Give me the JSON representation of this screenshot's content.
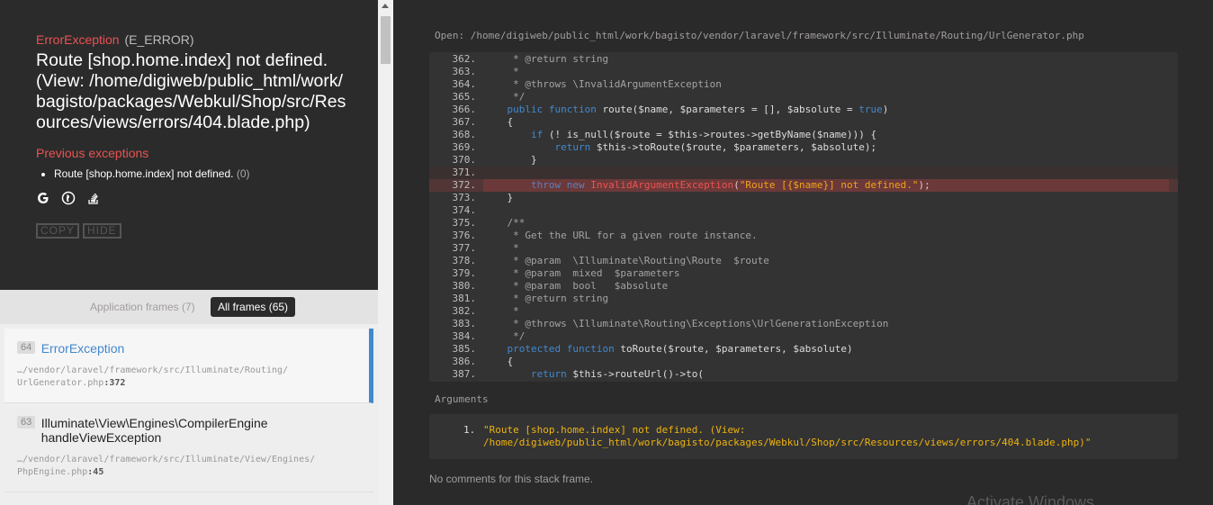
{
  "exception": {
    "class": "ErrorException",
    "code": "(E_ERROR)",
    "message": "Route [shop.home.index] not defined. (View: /home/digiweb/public_html/work/bagisto/packages/Webkul/Shop/src/Resources/views/errors/404.blade.php)",
    "previous_title": "Previous exceptions",
    "previous": [
      {
        "message": "Route [shop.home.index] not defined.",
        "count": "(0)"
      }
    ],
    "search_icons": [
      "google-icon",
      "duckduckgo-icon",
      "stackoverflow-icon"
    ],
    "copy_label": "COPY",
    "hide_label": "HIDE"
  },
  "tabs": {
    "application": "Application frames (7)",
    "all": "All frames (65)"
  },
  "frames": [
    {
      "index": "64",
      "class": "ErrorException",
      "method": "",
      "file_path": "…/vendor/laravel/framework/src/Illuminate/Routing/",
      "file_name": "UrlGenerator.php",
      "line": ":372"
    },
    {
      "index": "63",
      "class": "Illuminate\\View\\Engines\\CompilerEngine",
      "method": "handleViewException",
      "file_path": "…/vendor/laravel/framework/src/Illuminate/View/Engines/",
      "file_name": "PhpEngine.php",
      "line": ":45"
    }
  ],
  "code_view": {
    "open_label": "Open:",
    "file": "/home/digiweb/public_html/work/bagisto/vendor/laravel/framework/src/Illuminate/Routing/UrlGenerator.php",
    "lines": [
      {
        "n": "362.",
        "t": "     * @return string"
      },
      {
        "n": "363.",
        "t": "     *"
      },
      {
        "n": "364.",
        "t": "     * @throws \\InvalidArgumentException"
      },
      {
        "n": "365.",
        "t": "     */"
      },
      {
        "n": "366.",
        "t": "    public function route($name, $parameters = [], $absolute = true)"
      },
      {
        "n": "367.",
        "t": "    {"
      },
      {
        "n": "368.",
        "t": "        if (! is_null($route = $this->routes->getByName($name))) {"
      },
      {
        "n": "369.",
        "t": "            return $this->toRoute($route, $parameters, $absolute);"
      },
      {
        "n": "370.",
        "t": "        }"
      },
      {
        "n": "371.",
        "t": ""
      },
      {
        "n": "372.",
        "t": "        throw new InvalidArgumentException(\"Route [{$name}] not defined.\");"
      },
      {
        "n": "373.",
        "t": "    }"
      },
      {
        "n": "374.",
        "t": ""
      },
      {
        "n": "375.",
        "t": "    /**"
      },
      {
        "n": "376.",
        "t": "     * Get the URL for a given route instance."
      },
      {
        "n": "377.",
        "t": "     *"
      },
      {
        "n": "378.",
        "t": "     * @param  \\Illuminate\\Routing\\Route  $route"
      },
      {
        "n": "379.",
        "t": "     * @param  mixed  $parameters"
      },
      {
        "n": "380.",
        "t": "     * @param  bool   $absolute"
      },
      {
        "n": "381.",
        "t": "     * @return string"
      },
      {
        "n": "382.",
        "t": "     *"
      },
      {
        "n": "383.",
        "t": "     * @throws \\Illuminate\\Routing\\Exceptions\\UrlGenerationException"
      },
      {
        "n": "384.",
        "t": "     */"
      },
      {
        "n": "385.",
        "t": "    protected function toRoute($route, $parameters, $absolute)"
      },
      {
        "n": "386.",
        "t": "    {"
      },
      {
        "n": "387.",
        "t": "        return $this->routeUrl()->to("
      }
    ],
    "highlight_line": "372.",
    "arguments_title": "Arguments",
    "arguments": [
      {
        "num": "1.",
        "value": "\"Route [shop.home.index] not defined. (View:\n/home/digiweb/public_html/work/bagisto/packages/Webkul/Shop/src/Resources/views/errors/404.blade.php)\""
      }
    ],
    "no_comments": "No comments for this stack frame."
  },
  "watermark": "Activate Windows",
  "colors": {
    "accent_red": "#e95353",
    "link_blue": "#4288ce",
    "string_yellow": "#eeb30f",
    "panel_dark": "#2b2b2b"
  }
}
